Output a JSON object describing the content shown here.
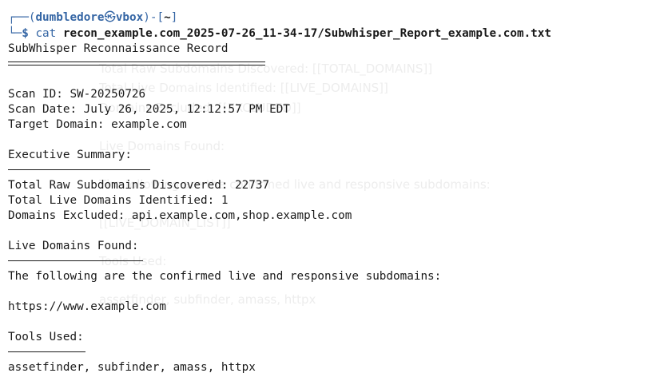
{
  "prompt": {
    "open": "┌──(",
    "user": "dumbledore",
    "skull": "㉿",
    "host": "vbox",
    "mid": ")-[",
    "dir": "~",
    "close": "]",
    "dollar": "$",
    "command": "cat",
    "argument": "recon_example.com_2025-07-26_11-34-17/Subwhisper_Report_example.com.txt"
  },
  "report": {
    "title": "SubWhisper Reconnaissance Record",
    "scan_id": "Scan ID: SW-20250726",
    "scan_date": "Scan Date: July 26, 2025, 12:12:57 PM EDT",
    "target_domain": "Target Domain: example.com",
    "executive_summary_heading": "Executive Summary:",
    "total_raw": "Total Raw Subdomains Discovered: 22737",
    "total_live": "Total Live Domains Identified: 1",
    "excluded": "Domains Excluded: api.example.com,shop.example.com",
    "live_heading": "Live Domains Found:",
    "live_intro": "The following are the confirmed live and responsive subdomains:",
    "live_domain": "https://www.example.com",
    "tools_heading": "Tools Used:",
    "tools_list": "assetfinder, subfinder, amass, httpx"
  },
  "ghost": {
    "g1": "Total Raw Subdomains Discovered: [[TOTAL_DOMAINS]]",
    "g2": "Total Live Domains Identified: [[LIVE_DOMAINS]]",
    "g3": "Domains Excluded: [[EXCLUDED]]",
    "g4": "Live Domains Found:",
    "g5": "The following are the confirmed live and responsive subdomains:",
    "g6": "[[LIVE_DOMAIN_LIST]]",
    "g7": "Tools Used:",
    "g8": "assetfinder, subfinder, amass, httpx"
  },
  "colors": {
    "prompt_blue": "#3465a4",
    "text": "#1a1a1a",
    "background": "#ffffff"
  }
}
